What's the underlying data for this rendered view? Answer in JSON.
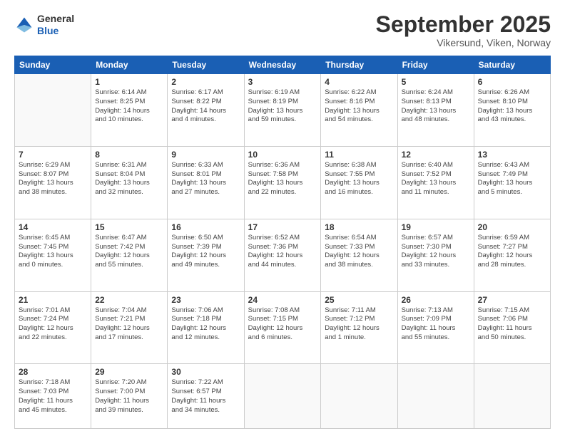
{
  "header": {
    "logo_general": "General",
    "logo_blue": "Blue",
    "month_title": "September 2025",
    "location": "Vikersund, Viken, Norway"
  },
  "columns": [
    "Sunday",
    "Monday",
    "Tuesday",
    "Wednesday",
    "Thursday",
    "Friday",
    "Saturday"
  ],
  "weeks": [
    [
      {
        "day": "",
        "info": ""
      },
      {
        "day": "1",
        "info": "Sunrise: 6:14 AM\nSunset: 8:25 PM\nDaylight: 14 hours\nand 10 minutes."
      },
      {
        "day": "2",
        "info": "Sunrise: 6:17 AM\nSunset: 8:22 PM\nDaylight: 14 hours\nand 4 minutes."
      },
      {
        "day": "3",
        "info": "Sunrise: 6:19 AM\nSunset: 8:19 PM\nDaylight: 13 hours\nand 59 minutes."
      },
      {
        "day": "4",
        "info": "Sunrise: 6:22 AM\nSunset: 8:16 PM\nDaylight: 13 hours\nand 54 minutes."
      },
      {
        "day": "5",
        "info": "Sunrise: 6:24 AM\nSunset: 8:13 PM\nDaylight: 13 hours\nand 48 minutes."
      },
      {
        "day": "6",
        "info": "Sunrise: 6:26 AM\nSunset: 8:10 PM\nDaylight: 13 hours\nand 43 minutes."
      }
    ],
    [
      {
        "day": "7",
        "info": "Sunrise: 6:29 AM\nSunset: 8:07 PM\nDaylight: 13 hours\nand 38 minutes."
      },
      {
        "day": "8",
        "info": "Sunrise: 6:31 AM\nSunset: 8:04 PM\nDaylight: 13 hours\nand 32 minutes."
      },
      {
        "day": "9",
        "info": "Sunrise: 6:33 AM\nSunset: 8:01 PM\nDaylight: 13 hours\nand 27 minutes."
      },
      {
        "day": "10",
        "info": "Sunrise: 6:36 AM\nSunset: 7:58 PM\nDaylight: 13 hours\nand 22 minutes."
      },
      {
        "day": "11",
        "info": "Sunrise: 6:38 AM\nSunset: 7:55 PM\nDaylight: 13 hours\nand 16 minutes."
      },
      {
        "day": "12",
        "info": "Sunrise: 6:40 AM\nSunset: 7:52 PM\nDaylight: 13 hours\nand 11 minutes."
      },
      {
        "day": "13",
        "info": "Sunrise: 6:43 AM\nSunset: 7:49 PM\nDaylight: 13 hours\nand 5 minutes."
      }
    ],
    [
      {
        "day": "14",
        "info": "Sunrise: 6:45 AM\nSunset: 7:45 PM\nDaylight: 13 hours\nand 0 minutes."
      },
      {
        "day": "15",
        "info": "Sunrise: 6:47 AM\nSunset: 7:42 PM\nDaylight: 12 hours\nand 55 minutes."
      },
      {
        "day": "16",
        "info": "Sunrise: 6:50 AM\nSunset: 7:39 PM\nDaylight: 12 hours\nand 49 minutes."
      },
      {
        "day": "17",
        "info": "Sunrise: 6:52 AM\nSunset: 7:36 PM\nDaylight: 12 hours\nand 44 minutes."
      },
      {
        "day": "18",
        "info": "Sunrise: 6:54 AM\nSunset: 7:33 PM\nDaylight: 12 hours\nand 38 minutes."
      },
      {
        "day": "19",
        "info": "Sunrise: 6:57 AM\nSunset: 7:30 PM\nDaylight: 12 hours\nand 33 minutes."
      },
      {
        "day": "20",
        "info": "Sunrise: 6:59 AM\nSunset: 7:27 PM\nDaylight: 12 hours\nand 28 minutes."
      }
    ],
    [
      {
        "day": "21",
        "info": "Sunrise: 7:01 AM\nSunset: 7:24 PM\nDaylight: 12 hours\nand 22 minutes."
      },
      {
        "day": "22",
        "info": "Sunrise: 7:04 AM\nSunset: 7:21 PM\nDaylight: 12 hours\nand 17 minutes."
      },
      {
        "day": "23",
        "info": "Sunrise: 7:06 AM\nSunset: 7:18 PM\nDaylight: 12 hours\nand 12 minutes."
      },
      {
        "day": "24",
        "info": "Sunrise: 7:08 AM\nSunset: 7:15 PM\nDaylight: 12 hours\nand 6 minutes."
      },
      {
        "day": "25",
        "info": "Sunrise: 7:11 AM\nSunset: 7:12 PM\nDaylight: 12 hours\nand 1 minute."
      },
      {
        "day": "26",
        "info": "Sunrise: 7:13 AM\nSunset: 7:09 PM\nDaylight: 11 hours\nand 55 minutes."
      },
      {
        "day": "27",
        "info": "Sunrise: 7:15 AM\nSunset: 7:06 PM\nDaylight: 11 hours\nand 50 minutes."
      }
    ],
    [
      {
        "day": "28",
        "info": "Sunrise: 7:18 AM\nSunset: 7:03 PM\nDaylight: 11 hours\nand 45 minutes."
      },
      {
        "day": "29",
        "info": "Sunrise: 7:20 AM\nSunset: 7:00 PM\nDaylight: 11 hours\nand 39 minutes."
      },
      {
        "day": "30",
        "info": "Sunrise: 7:22 AM\nSunset: 6:57 PM\nDaylight: 11 hours\nand 34 minutes."
      },
      {
        "day": "",
        "info": ""
      },
      {
        "day": "",
        "info": ""
      },
      {
        "day": "",
        "info": ""
      },
      {
        "day": "",
        "info": ""
      }
    ]
  ]
}
